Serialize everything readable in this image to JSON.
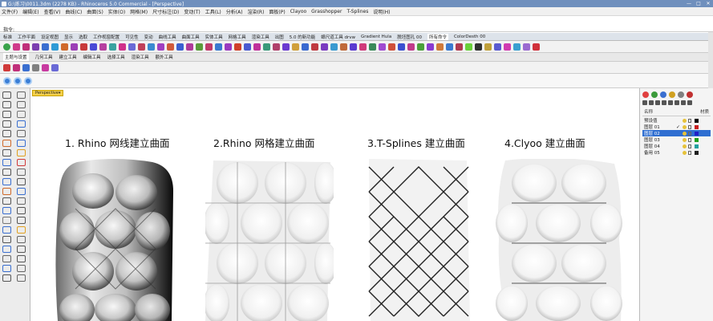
{
  "window": {
    "title": "G:\\练习\\0011.3dm (2278 KB) - Rhinoceros 5.0 Commercial - [Perspective]",
    "controls": [
      "—",
      "□",
      "✕"
    ]
  },
  "menu": [
    "文件(F)",
    "编辑(E)",
    "查看(V)",
    "曲线(C)",
    "曲面(S)",
    "实体(O)",
    "网格(M)",
    "尺寸标注(D)",
    "变动(T)",
    "工具(L)",
    "分析(A)",
    "渲染(R)",
    "面板(P)",
    "Clayoo",
    "Grasshopper",
    "T-Splines",
    "说明(H)"
  ],
  "command": {
    "prompt": "指令:"
  },
  "toolbar_tabs": {
    "items": [
      "标准",
      "工作平面",
      "设定视图",
      "显示",
      "选取",
      "工作视窗配置",
      "可见性",
      "变动",
      "曲线工具",
      "曲面工具",
      "实体工具",
      "网格工具",
      "渲染工具",
      "出图",
      "5.0 的新功能",
      "蟑尺道工具 drvw",
      "Gradient Hula",
      "脱坯图孔 00",
      "所有命令",
      "ColorDesth 00"
    ],
    "active_index": 18
  },
  "icon_row_colors": [
    "#3aa34a",
    "#d03a8a",
    "#c0307a",
    "#7b3fb0",
    "#3a6fd0",
    "#2f9bd6",
    "#d06a2a",
    "#9c3fb6",
    "#c83a3a",
    "#4a4ad6",
    "#b63fa0",
    "#3aa3a0",
    "#d0308a",
    "#6a6ad6",
    "#c0405a",
    "#3a8ad0",
    "#a03fc0",
    "#d05a3a",
    "#3a60d0",
    "#b03a9a",
    "#5a9c3a",
    "#c03a6a",
    "#3a7ad0",
    "#9a3ac0",
    "#d0402a",
    "#4a5ad0",
    "#c0309a",
    "#3a9a7a",
    "#b0406a",
    "#6a3ad0",
    "#d0a03a",
    "#3a6ad0",
    "#c03a40",
    "#7a3ac0",
    "#3a9ad0",
    "#c06a3a",
    "#5a3ad0",
    "#d03a7a",
    "#3a8a5a",
    "#a04ad0",
    "#d0503a",
    "#3a50d0",
    "#c03a8a",
    "#4aa03a",
    "#8a3ad0",
    "#d07a3a",
    "#3a7ad0",
    "#b03a50",
    "#6ad03a",
    "#303030",
    "#c0a03a",
    "#5a5ad0",
    "#d03ab0",
    "#3aa0d0",
    "#9a6ad0",
    "#d0303a"
  ],
  "sub_tabs": {
    "items": [
      "主题与设置",
      "几何工具",
      "建立工具",
      "编辑工具",
      "选择工具",
      "渲染工具",
      "额外工具"
    ],
    "active_index": 0
  },
  "icon_row2_colors": [
    "#d03a3a",
    "#c0307a",
    "#3a6fd0",
    "#808080",
    "#c83aa0",
    "#6a6ad6"
  ],
  "left_tool_colors": [
    "#555",
    "#666",
    "#555",
    "#666",
    "#555",
    "#777",
    "#555",
    "#3a6fd0",
    "#555",
    "#666",
    "#d06a2a",
    "#3a6fd0",
    "#555",
    "#e0a020",
    "#3a6fd0",
    "#d03a3a",
    "#555",
    "#666",
    "#3a6fd0",
    "#555",
    "#d06a2a",
    "#3a6fd0",
    "#555",
    "#666",
    "#3a6fd0",
    "#555",
    "#777",
    "#555",
    "#3a6fd0",
    "#e0a020",
    "#555",
    "#666",
    "#3a6fd0",
    "#555",
    "#666",
    "#555",
    "#3a6fd0",
    "#666",
    "#555",
    "#666"
  ],
  "viewport": {
    "tab": "Perspective",
    "panels": [
      {
        "title": "1. Rhino 网线建立曲面",
        "style": "dark"
      },
      {
        "title": "2.Rhino 网格建立曲面",
        "style": "light"
      },
      {
        "title": "3.T-Splines 建立曲面",
        "style": "dark-lines"
      },
      {
        "title": "4.Clyoo 建立曲面",
        "style": "soft"
      }
    ]
  },
  "layers_panel": {
    "header_left": "名称",
    "header_right": "材质",
    "rows": [
      {
        "name": "预设值",
        "current": false,
        "color": "#000000"
      },
      {
        "name": "图层 01",
        "current": true,
        "color": "#c82020"
      },
      {
        "name": "图层 02",
        "current": false,
        "color": "#2020c8",
        "selected": true
      },
      {
        "name": "图层 03",
        "current": false,
        "color": "#20a020"
      },
      {
        "name": "图层 04",
        "current": false,
        "color": "#20a0a0"
      },
      {
        "name": "备用 05",
        "current": false,
        "color": "#202020"
      }
    ],
    "tab_colors": [
      "#e04040",
      "#3a9a3a",
      "#3a6fd0",
      "#d0a020",
      "#808080",
      "#c03030"
    ]
  }
}
